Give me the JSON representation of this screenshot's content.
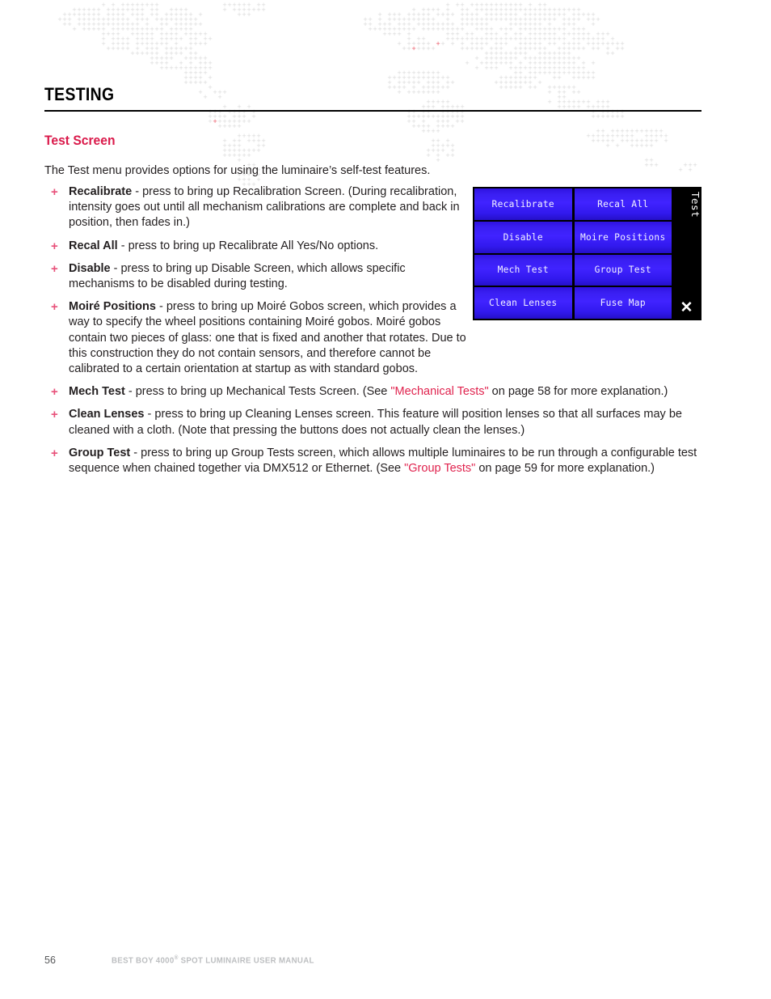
{
  "document": {
    "chapter_title": "TESTING",
    "section_title": "Test Screen",
    "intro": "The Test menu provides options for using the luminaire’s self-test features."
  },
  "bullets": [
    {
      "marker": "+",
      "term": "Recalibrate",
      "text": " - press to bring up Recalibration Screen. (During recalibration, intensity goes out until all mechanism calibrations are complete and back in position, then fades in.)",
      "width": "narrow"
    },
    {
      "marker": "+",
      "term": "Recal All",
      "text": " - press to bring up Recalibrate All Yes/No options.",
      "width": "narrow"
    },
    {
      "marker": "+",
      "term": "Disable",
      "text": " - press to bring up Disable Screen, which allows specific mechanisms to be disabled during testing.",
      "width": "narrow"
    },
    {
      "marker": "+",
      "term": "Moiré Positions",
      "text": " - press to bring up Moiré Gobos screen, which provides a way to specify the wheel positions containing Moiré gobos. Moiré gobos contain two pieces of glass: one that is fixed and another that rotates. Due to this construction they do not contain sensors, and therefore cannot be calibrated to a certain orientation at startup as with standard gobos.",
      "width": "narrow"
    },
    {
      "marker": "+",
      "term": "Mech Test",
      "text_before": " - press to bring up Mechanical Tests Screen. (See ",
      "link": "\"Mechanical Tests\"",
      "text_after": " on page 58 for more explanation.)",
      "width": "wide"
    },
    {
      "marker": "+",
      "term": "Clean Lenses",
      "text": " - press to bring up Cleaning Lenses screen. This feature will position lenses so that all surfaces may be cleaned with a cloth. (Note that pressing the buttons does not actually clean the lenses.)",
      "width": "wide"
    },
    {
      "marker": "+",
      "term": "Group Test",
      "text_before": " - press to bring up Group Tests screen, which allows multiple luminaires to be run through a configurable test sequence when chained together via DMX512 or Ethernet. (See ",
      "link": "\"Group Tests\"",
      "text_after": " on page 59 for more explanation.)",
      "width": "wide"
    }
  ],
  "lcd": {
    "side_label": "Test",
    "close_icon": "✕",
    "rows": [
      [
        "Recalibrate",
        "Recal All"
      ],
      [
        "Disable",
        "Moire Positions"
      ],
      [
        "Mech Test",
        "Group Test"
      ],
      [
        "Clean Lenses",
        "Fuse Map"
      ]
    ]
  },
  "footer": {
    "page_number": "56",
    "manual_name_prefix": "BEST BOY 4000",
    "manual_name_sup": "®",
    "manual_name_suffix": " SPOT LUMINAIRE USER MANUAL"
  },
  "colors": {
    "accent_red": "#DA1A4B",
    "link_red": "#E0234E",
    "bullet_pink": "#E8517A",
    "lcd_blue": "#4023FF",
    "lcd_black": "#000000",
    "body_text": "#231F20",
    "footer_gray": "#BCBEC0",
    "watermark_gray": "#D9D9D9",
    "watermark_red": "#E8505F"
  }
}
